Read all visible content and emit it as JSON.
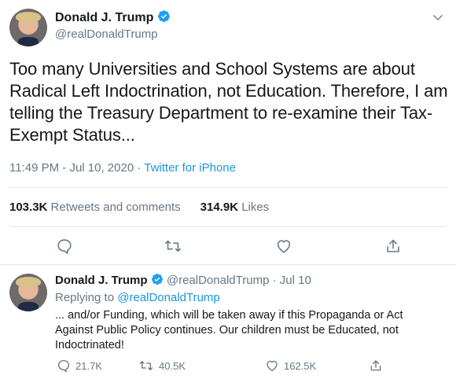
{
  "main_tweet": {
    "author_name": "Donald J. Trump",
    "handle": "@realDonaldTrump",
    "text": "Too many Universities and School Systems are about Radical Left Indoctrination, not Education. Therefore, I am telling the Treasury Department to re-examine their Tax-Exempt Status...",
    "time": "11:49 PM",
    "date": "Jul 10, 2020",
    "separator": "·",
    "source": "Twitter for iPhone",
    "retweets_count": "103.3K",
    "retweets_label": "Retweets and comments",
    "likes_count": "314.9K",
    "likes_label": "Likes",
    "icons": [
      "verified-badge-icon",
      "chevron-down-icon",
      "reply-icon",
      "retweet-icon",
      "like-icon",
      "share-icon"
    ]
  },
  "reply_tweet": {
    "author_name": "Donald J. Trump",
    "handle": "@realDonaldTrump",
    "separator": "·",
    "date": "Jul 10",
    "replying_prefix": "Replying to",
    "replying_handle": "@realDonaldTrump",
    "text": "... and/or Funding, which will be taken away if this Propaganda or Act Against Public Policy continues. Our children must be Educated, not Indoctrinated!",
    "reply_count": "21.7K",
    "retweet_count": "40.5K",
    "like_count": "162.5K"
  },
  "colors": {
    "accent": "#1b95e0",
    "text": "#14171a",
    "muted": "#657786",
    "divider": "#e1e8ed"
  }
}
